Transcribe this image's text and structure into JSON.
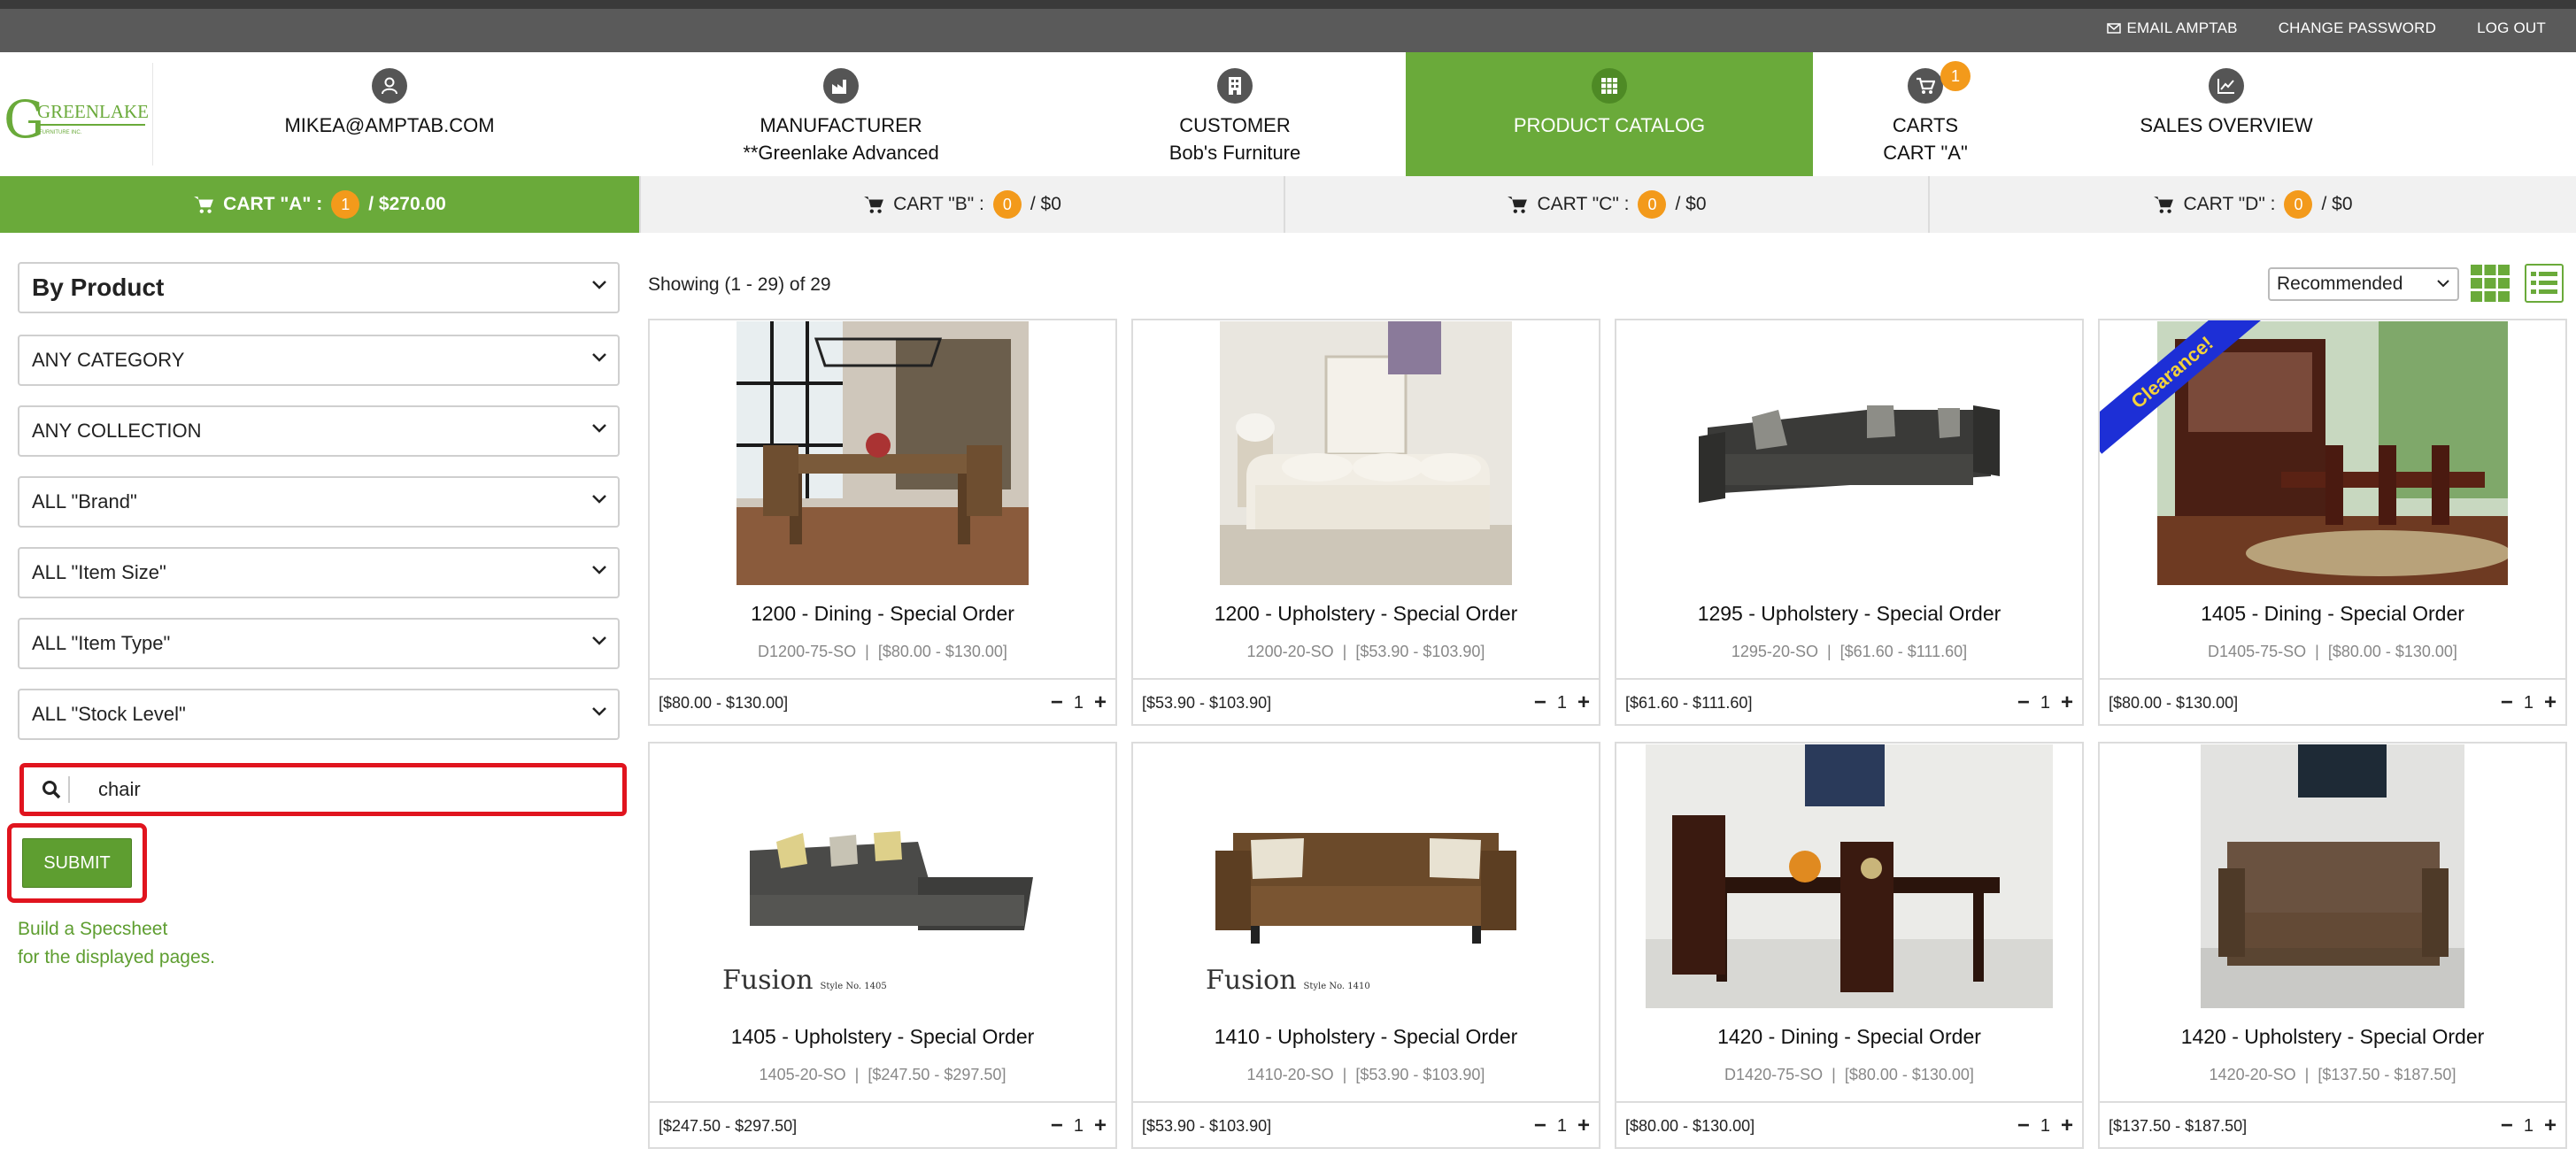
{
  "util": {
    "email": "EMAIL AMPTAB",
    "change_password": "CHANGE PASSWORD",
    "logout": "LOG OUT"
  },
  "logo": {
    "text": "GREENLAKE"
  },
  "nav": {
    "user": "MIKEA@AMPTAB.COM",
    "manufacturer_label": "MANUFACTURER",
    "manufacturer_value": "**Greenlake Advanced",
    "customer_label": "CUSTOMER",
    "customer_value": "Bob's Furniture",
    "catalog": "PRODUCT CATALOG",
    "carts_label": "CARTS",
    "carts_value": "CART \"A\"",
    "carts_badge": "1",
    "sales": "SALES OVERVIEW"
  },
  "carts": [
    {
      "label": "CART \"A\" :",
      "count": "1",
      "total": "/ $270.00"
    },
    {
      "label": "CART \"B\" :",
      "count": "0",
      "total": "/ $0"
    },
    {
      "label": "CART \"C\" :",
      "count": "0",
      "total": "/ $0"
    },
    {
      "label": "CART \"D\" :",
      "count": "0",
      "total": "/ $0"
    }
  ],
  "filters": {
    "mode": "By Product",
    "category": "ANY CATEGORY",
    "collection": "ANY COLLECTION",
    "brand": "ALL \"Brand\"",
    "item_size": "ALL \"Item Size\"",
    "item_type": "ALL \"Item Type\"",
    "stock_level": "ALL \"Stock Level\"",
    "search_value": "chair",
    "submit": "SUBMIT",
    "specsheet_line1": "Build a Specsheet",
    "specsheet_line2": "for the displayed pages."
  },
  "results": {
    "showing": "Showing (1 - 29) of 29",
    "sort": "Recommended"
  },
  "products": [
    {
      "title": "1200 - Dining - Special Order",
      "sku": "D1200-75-SO",
      "range": "[$80.00 - $130.00]",
      "qty": "1"
    },
    {
      "title": "1200 - Upholstery - Special Order",
      "sku": "1200-20-SO",
      "range": "[$53.90 - $103.90]",
      "qty": "1"
    },
    {
      "title": "1295 - Upholstery - Special Order",
      "sku": "1295-20-SO",
      "range": "[$61.60 - $111.60]",
      "qty": "1"
    },
    {
      "title": "1405 - Dining - Special Order",
      "sku": "D1405-75-SO",
      "range": "[$80.00 - $130.00]",
      "qty": "1",
      "ribbon": "Clearance!"
    },
    {
      "title": "1405 - Upholstery - Special Order",
      "sku": "1405-20-SO",
      "range": "[$247.50 - $297.50]",
      "qty": "1",
      "brand": "Fusion"
    },
    {
      "title": "1410 - Upholstery - Special Order",
      "sku": "1410-20-SO",
      "range": "[$53.90 - $103.90]",
      "qty": "1",
      "brand": "Fusion"
    },
    {
      "title": "1420 - Dining - Special Order",
      "sku": "D1420-75-SO",
      "range": "[$80.00 - $130.00]",
      "qty": "1"
    },
    {
      "title": "1420 - Upholstery - Special Order",
      "sku": "1420-20-SO",
      "range": "[$137.50 - $187.50]",
      "qty": "1"
    }
  ],
  "colors": {
    "brand_green": "#6aaa3a",
    "badge_orange": "#f39a1b",
    "highlight_red": "#e0141e"
  }
}
